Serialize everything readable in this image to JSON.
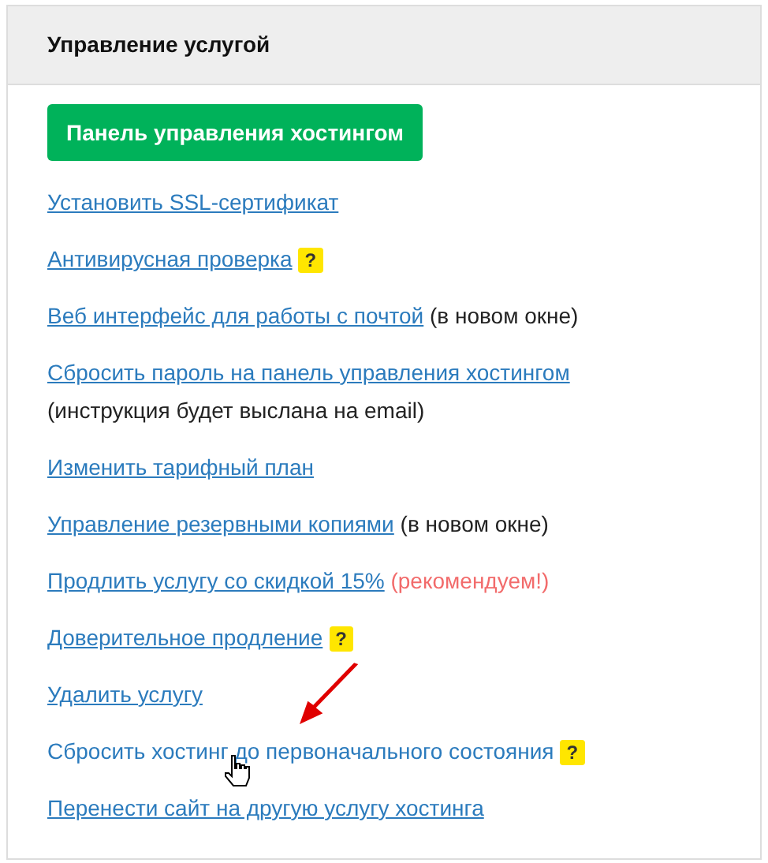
{
  "panel": {
    "title": "Управление услугой"
  },
  "primary_button": {
    "label": "Панель управления хостингом"
  },
  "links": [
    {
      "label": "Установить SSL-сертификат",
      "hovered": false
    },
    {
      "label": "Антивирусная проверка",
      "help": "?",
      "hovered": false
    },
    {
      "label": "Веб интерфейс для работы с почтой",
      "note": "(в новом окне)",
      "kind": "plain",
      "hovered": false
    },
    {
      "label": "Сбросить пароль на панель управления хостингом",
      "note": "(инструкция будет выслана на email)",
      "kind": "plain",
      "hovered": false
    },
    {
      "label": "Изменить тарифный план",
      "hovered": false
    },
    {
      "label": "Управление резервными копиями",
      "note": "(в новом окне)",
      "kind": "plain",
      "hovered": false
    },
    {
      "label": "Продлить услугу со скидкой 15%",
      "note": "(рекомендуем!)",
      "kind": "accent",
      "hovered": false
    },
    {
      "label": "Доверительное продление",
      "help": "?",
      "hovered": false
    },
    {
      "label": "Удалить услугу",
      "hovered": false
    },
    {
      "label": "Сбросить хостинг до первоначального состояния",
      "help": "?",
      "hovered": true
    },
    {
      "label": "Перенести сайт на другую услугу хостинга",
      "hovered": false
    }
  ]
}
